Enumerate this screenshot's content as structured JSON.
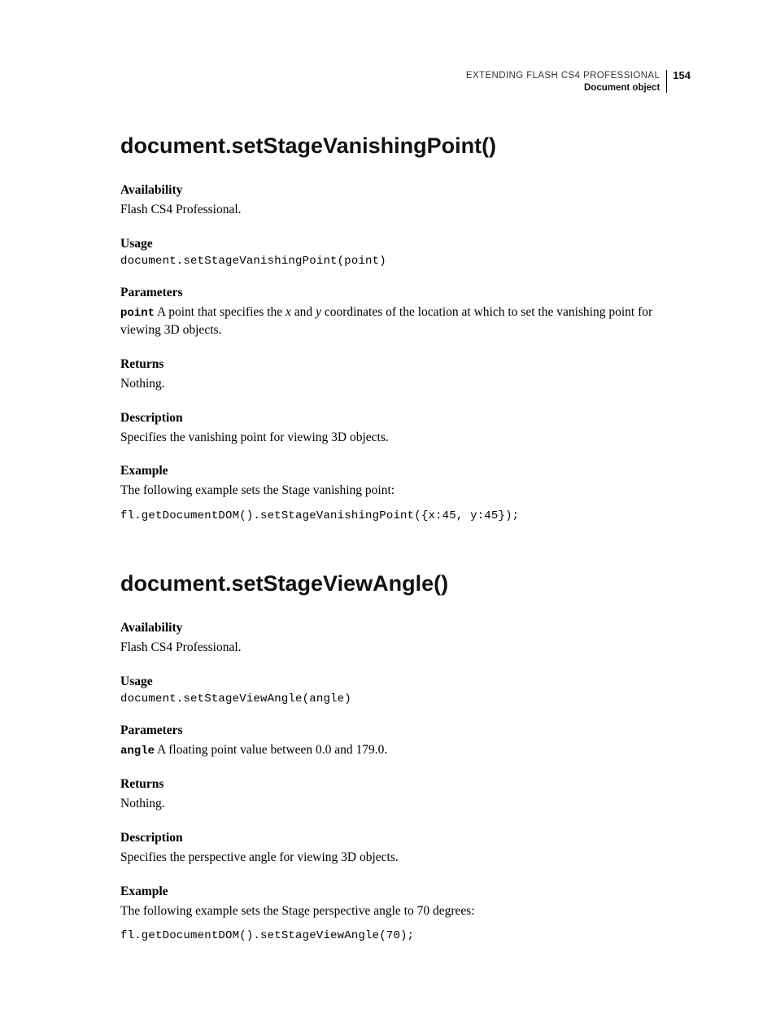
{
  "header": {
    "line1": "EXTENDING FLASH CS4 PROFESSIONAL",
    "line2": "Document object",
    "page_number": "154"
  },
  "sections": [
    {
      "title": "document.setStageVanishingPoint()",
      "availability": {
        "h": "Availability",
        "t": "Flash CS4 Professional."
      },
      "usage": {
        "h": "Usage",
        "code": "document.setStageVanishingPoint(point)"
      },
      "parameters": {
        "h": "Parameters",
        "param_name": "point",
        "param_pre": "  A point that specifies the ",
        "x": "x",
        "and": " and ",
        "y": "y",
        "param_post": " coordinates of the location at which to set the vanishing point for viewing 3D objects."
      },
      "returns": {
        "h": "Returns",
        "t": "Nothing."
      },
      "description": {
        "h": "Description",
        "t": "Specifies the vanishing point for viewing 3D objects."
      },
      "example": {
        "h": "Example",
        "t": "The following example sets the Stage vanishing point:",
        "code": "fl.getDocumentDOM().setStageVanishingPoint({x:45, y:45});"
      }
    },
    {
      "title": "document.setStageViewAngle()",
      "availability": {
        "h": "Availability",
        "t": "Flash CS4 Professional."
      },
      "usage": {
        "h": "Usage",
        "code": "document.setStageViewAngle(angle)"
      },
      "parameters": {
        "h": "Parameters",
        "param_name": "angle",
        "param_text": "  A floating point value between 0.0 and 179.0."
      },
      "returns": {
        "h": "Returns",
        "t": "Nothing."
      },
      "description": {
        "h": "Description",
        "t": "Specifies the perspective angle for viewing 3D objects."
      },
      "example": {
        "h": "Example",
        "t": "The following example sets the Stage perspective angle to 70 degrees:",
        "code": "fl.getDocumentDOM().setStageViewAngle(70);"
      }
    }
  ]
}
